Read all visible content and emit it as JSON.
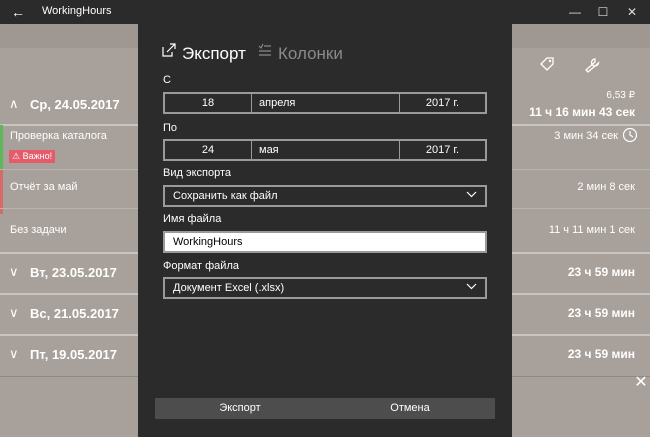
{
  "window": {
    "title": "WorkingHours",
    "back": "←",
    "minimize": "—",
    "maximize": "☐",
    "close": "✕"
  },
  "background": {
    "days": [
      {
        "chevron": "∧",
        "date": "Ср, 24.05.2017",
        "money": "6,53 ₽",
        "total": "11 ч 16 мин 43 сек",
        "tasks": [
          {
            "name": "Проверка каталога",
            "badge": "⚠ Важно!",
            "duration": "3 мин 34 сек",
            "bar_color": "#5fb857"
          },
          {
            "name": "Отчёт за май",
            "duration": "2 мин 8 сек",
            "bar_color": "#d66a6a"
          },
          {
            "name": "Без задачи",
            "duration": "11 ч 11 мин 1 сек",
            "bar_color": "#a8a19b"
          }
        ]
      },
      {
        "chevron": "∨",
        "date": "Вт, 23.05.2017",
        "total": "23 ч 59 мин"
      },
      {
        "chevron": "∨",
        "date": "Вс, 21.05.2017",
        "total": "23 ч 59 мин"
      },
      {
        "chevron": "∨",
        "date": "Пт, 19.05.2017",
        "total": "23 ч 59 мин"
      }
    ]
  },
  "dialog": {
    "tabs": [
      {
        "icon": "export-icon",
        "glyph": "⇱",
        "label": "Экспорт",
        "active": true
      },
      {
        "icon": "columns-icon",
        "glyph": "☰",
        "label": "Колонки",
        "active": false
      }
    ],
    "from": {
      "label": "С",
      "day": "18",
      "month": "апреля",
      "year": "2017 г."
    },
    "to": {
      "label": "По",
      "day": "24",
      "month": "мая",
      "year": "2017 г."
    },
    "export_type": {
      "label": "Вид экспорта",
      "value": "Сохранить как файл"
    },
    "file_name": {
      "label": "Имя файла",
      "value": "WorkingHours"
    },
    "file_format": {
      "label": "Формат файла",
      "value": "Документ Excel (.xlsx)"
    },
    "buttons": {
      "export": "Экспорт",
      "cancel": "Отмена"
    }
  },
  "colors": {
    "accent_green": "#5fb857",
    "accent_red": "#d66a6a",
    "badge": "#e45c6a"
  }
}
